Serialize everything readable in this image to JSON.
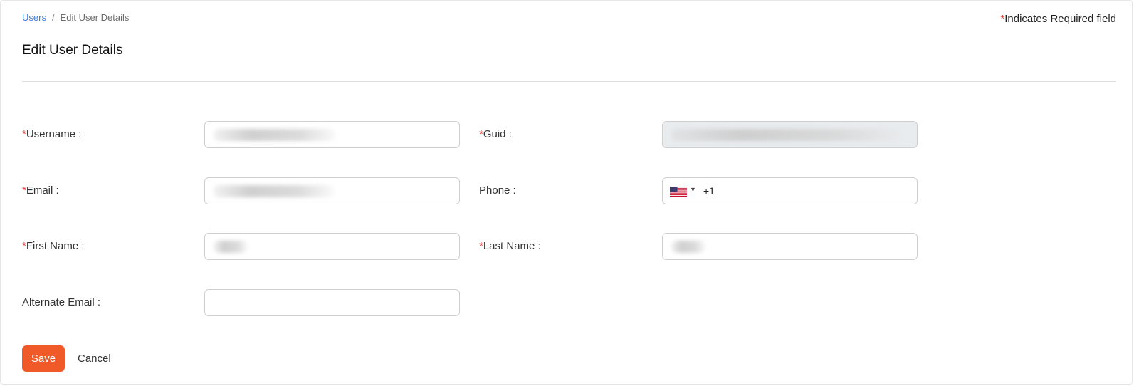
{
  "breadcrumb": {
    "root": "Users",
    "separator": "/",
    "current": "Edit User Details"
  },
  "required_note": {
    "asterisk": "*",
    "text": "Indicates Required field"
  },
  "page_title": "Edit User Details",
  "form": {
    "username": {
      "asterisk": "*",
      "label": "Username :",
      "value": ""
    },
    "guid": {
      "asterisk": "*",
      "label": "Guid :",
      "value": ""
    },
    "email": {
      "asterisk": "*",
      "label": "Email :",
      "value": ""
    },
    "phone": {
      "label": "Phone :",
      "country_icon": "us-flag-icon",
      "dial_code": "+1",
      "value": ""
    },
    "first_name": {
      "asterisk": "*",
      "label": "First Name :",
      "value": ""
    },
    "last_name": {
      "asterisk": "*",
      "label": "Last Name :",
      "value": ""
    },
    "alternate_email": {
      "label": "Alternate Email :",
      "value": ""
    }
  },
  "actions": {
    "save_label": "Save",
    "cancel_label": "Cancel"
  },
  "colors": {
    "accent": "#f05a28",
    "link": "#3d7bd9",
    "required": "#e53935",
    "disabled_bg": "#e9ecef"
  }
}
